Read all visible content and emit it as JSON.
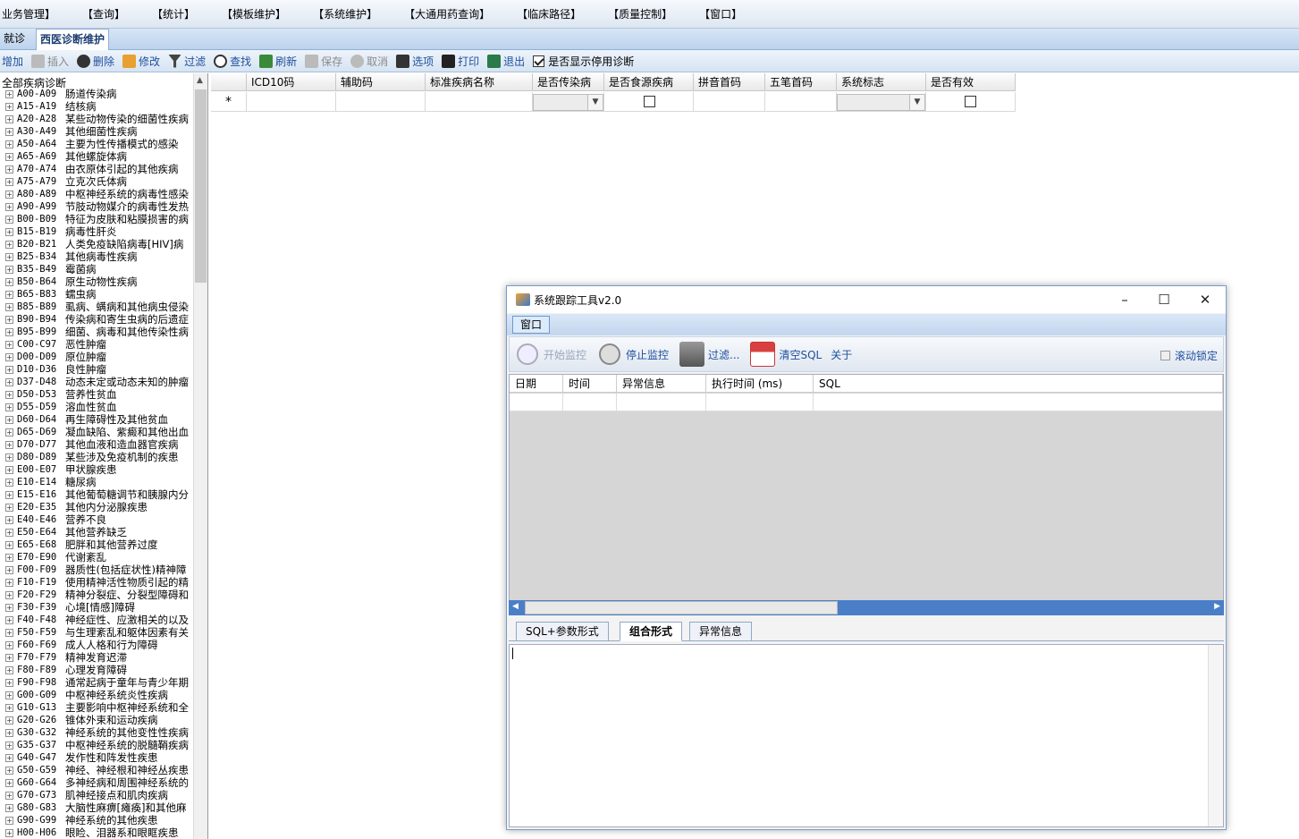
{
  "menu": [
    "业务管理】",
    "【查询】",
    "【统计】",
    "【模板维护】",
    "【系统维护】",
    "【大通用药查询】",
    "【临床路径】",
    "【质量控制】",
    "【窗口】"
  ],
  "tabs": {
    "prev": "就诊",
    "active": "西医诊断维护"
  },
  "toolbar": {
    "add": "增加",
    "insert": "插入",
    "delete": "删除",
    "modify": "修改",
    "filter": "过滤",
    "find": "查找",
    "refresh": "刷新",
    "save": "保存",
    "cancel": "取消",
    "options": "选项",
    "print": "打印",
    "exit": "退出",
    "show_disabled": "是否显示停用诊断"
  },
  "tree": {
    "root": "全部疾病诊断",
    "nodes": [
      {
        "code": "A00-A09",
        "name": "肠道传染病"
      },
      {
        "code": "A15-A19",
        "name": "结核病"
      },
      {
        "code": "A20-A28",
        "name": "某些动物传染的细菌性疾病"
      },
      {
        "code": "A30-A49",
        "name": "其他细菌性疾病"
      },
      {
        "code": "A50-A64",
        "name": "主要为性传播模式的感染"
      },
      {
        "code": "A65-A69",
        "name": "其他螺旋体病"
      },
      {
        "code": "A70-A74",
        "name": "由衣原体引起的其他疾病"
      },
      {
        "code": "A75-A79",
        "name": "立克次氏体病"
      },
      {
        "code": "A80-A89",
        "name": "中枢神经系统的病毒性感染"
      },
      {
        "code": "A90-A99",
        "name": "节肢动物媒介的病毒性发热"
      },
      {
        "code": "B00-B09",
        "name": "特征为皮肤和粘膜损害的病"
      },
      {
        "code": "B15-B19",
        "name": "病毒性肝炎"
      },
      {
        "code": "B20-B21",
        "name": "人类免疫缺陷病毒[HIV]病"
      },
      {
        "code": "B25-B34",
        "name": "其他病毒性疾病"
      },
      {
        "code": "B35-B49",
        "name": "霉菌病"
      },
      {
        "code": "B50-B64",
        "name": "原生动物性疾病"
      },
      {
        "code": "B65-B83",
        "name": "蠕虫病"
      },
      {
        "code": "B85-B89",
        "name": "虱病、螨病和其他病虫侵染"
      },
      {
        "code": "B90-B94",
        "name": "传染病和寄生虫病的后遗症"
      },
      {
        "code": "B95-B99",
        "name": "细菌、病毒和其他传染性病"
      },
      {
        "code": "C00-C97",
        "name": "恶性肿瘤"
      },
      {
        "code": "D00-D09",
        "name": "原位肿瘤"
      },
      {
        "code": "D10-D36",
        "name": "良性肿瘤"
      },
      {
        "code": "D37-D48",
        "name": "动态未定或动态未知的肿瘤"
      },
      {
        "code": "D50-D53",
        "name": "营养性贫血"
      },
      {
        "code": "D55-D59",
        "name": "溶血性贫血"
      },
      {
        "code": "D60-D64",
        "name": "再生障碍性及其他贫血"
      },
      {
        "code": "D65-D69",
        "name": "凝血缺陷、紫癜和其他出血"
      },
      {
        "code": "D70-D77",
        "name": "其他血液和造血器官疾病"
      },
      {
        "code": "D80-D89",
        "name": "某些涉及免疫机制的疾患"
      },
      {
        "code": "E00-E07",
        "name": "甲状腺疾患"
      },
      {
        "code": "E10-E14",
        "name": "糖尿病"
      },
      {
        "code": "E15-E16",
        "name": "其他葡萄糖调节和胰腺内分"
      },
      {
        "code": "E20-E35",
        "name": "其他内分泌腺疾患"
      },
      {
        "code": "E40-E46",
        "name": "营养不良"
      },
      {
        "code": "E50-E64",
        "name": "其他营养缺乏"
      },
      {
        "code": "E65-E68",
        "name": "肥胖和其他营养过度"
      },
      {
        "code": "E70-E90",
        "name": "代谢紊乱"
      },
      {
        "code": "F00-F09",
        "name": "器质性(包括症状性)精神障"
      },
      {
        "code": "F10-F19",
        "name": "使用精神活性物质引起的精"
      },
      {
        "code": "F20-F29",
        "name": "精神分裂症、分裂型障碍和"
      },
      {
        "code": "F30-F39",
        "name": "心境[情感]障碍"
      },
      {
        "code": "F40-F48",
        "name": "神经症性、应激相关的以及"
      },
      {
        "code": "F50-F59",
        "name": "与生理紊乱和躯体因素有关"
      },
      {
        "code": "F60-F69",
        "name": "成人人格和行为障碍"
      },
      {
        "code": "F70-F79",
        "name": "精神发育迟滞"
      },
      {
        "code": "F80-F89",
        "name": "心理发育障碍"
      },
      {
        "code": "F90-F98",
        "name": "通常起病于童年与青少年期"
      },
      {
        "code": "G00-G09",
        "name": "中枢神经系统炎性疾病"
      },
      {
        "code": "G10-G13",
        "name": "主要影响中枢神经系统和全"
      },
      {
        "code": "G20-G26",
        "name": "锥体外束和运动疾病"
      },
      {
        "code": "G30-G32",
        "name": "神经系统的其他变性性疾病"
      },
      {
        "code": "G35-G37",
        "name": "中枢神经系统的脱髓鞘疾病"
      },
      {
        "code": "G40-G47",
        "name": "发作性和阵发性疾患"
      },
      {
        "code": "G50-G59",
        "name": "神经、神经根和神经丛疾患"
      },
      {
        "code": "G60-G64",
        "name": "多神经病和周围神经系统的"
      },
      {
        "code": "G70-G73",
        "name": "肌神经接点和肌肉疾病"
      },
      {
        "code": "G80-G83",
        "name": "大脑性麻痹[瘫痪]和其他麻"
      },
      {
        "code": "G90-G99",
        "name": "神经系统的其他疾患"
      },
      {
        "code": "H00-H06",
        "name": "眼睑、泪器系和眼眶疾患"
      }
    ]
  },
  "grid": {
    "columns": [
      "ICD10码",
      "辅助码",
      "标准疾病名称",
      "是否传染病",
      "是否食源疾病",
      "拼音首码",
      "五笔首码",
      "系统标志",
      "是否有效"
    ],
    "new_row_marker": "*"
  },
  "dialog": {
    "title": "系统跟踪工具v2.0",
    "menu": "窗口",
    "buttons": {
      "start": "开始监控",
      "stop": "停止监控",
      "filter": "过滤...",
      "clear": "清空SQL",
      "about": "关于",
      "scroll_lock": "滚动锁定"
    },
    "columns": [
      "日期",
      "时间",
      "异常信息",
      "执行时间 (ms)",
      "SQL"
    ],
    "tabs": [
      "SQL+参数形式",
      "组合形式",
      "异常信息"
    ],
    "active_tab": "组合形式"
  }
}
